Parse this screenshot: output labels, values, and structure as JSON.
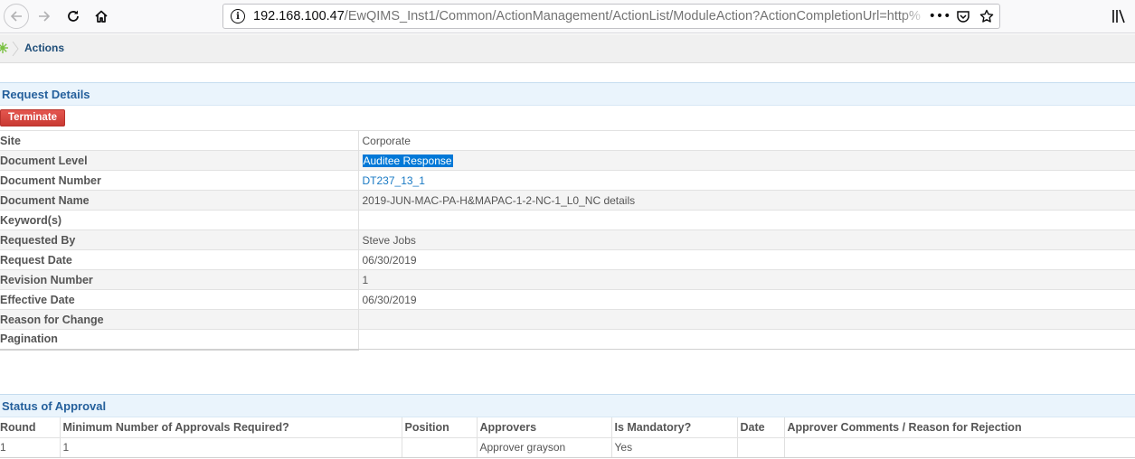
{
  "browser": {
    "url_host": "192.168.100.47",
    "url_path": "/EwQIMS_Inst1/Common/ActionManagement/ActionList/ModuleAction?ActionCompletionUrl=http%",
    "icons": [
      "back-arrow-icon",
      "forward-arrow-icon",
      "reload-icon",
      "home-icon",
      "info-icon",
      "more-dots-icon",
      "pocket-icon",
      "bookmark-star-icon",
      "library-icon"
    ],
    "more_glyph": "•••"
  },
  "breadcrumb": {
    "current": "Actions"
  },
  "request_details": {
    "title": "Request Details",
    "terminate_label": "Terminate",
    "rows": [
      {
        "label": "Site",
        "value": "Corporate"
      },
      {
        "label": "Document Level",
        "value": "Auditee Response"
      },
      {
        "label": "Document Number",
        "value": "DT237_13_1"
      },
      {
        "label": "Document Name",
        "value": "2019-JUN-MAC-PA-H&MAPAC-1-2-NC-1_L0_NC details"
      },
      {
        "label": "Keyword(s)",
        "value": ""
      },
      {
        "label": "Requested By",
        "value": "Steve Jobs"
      },
      {
        "label": "Request Date",
        "value": "06/30/2019"
      },
      {
        "label": "Revision Number",
        "value": "1"
      },
      {
        "label": "Effective Date",
        "value": "06/30/2019"
      },
      {
        "label": "Reason for Change",
        "value": ""
      },
      {
        "label": "Pagination",
        "value": ""
      }
    ]
  },
  "status_of_approval": {
    "title": "Status of Approval",
    "columns": [
      "Round",
      "Minimum Number of Approvals Required?",
      "Position",
      "Approvers",
      "Is Mandatory?",
      "Date",
      "Approver Comments / Reason for Rejection"
    ],
    "rows": [
      [
        "1",
        "1",
        "",
        "Approver grayson",
        "Yes",
        "",
        ""
      ]
    ]
  },
  "colors": {
    "section_header_bg": "#eaf4fc",
    "section_title": "#25609c",
    "terminate_button": "#d9443d",
    "link": "#1a7ac4",
    "selection": "#0078d7"
  }
}
